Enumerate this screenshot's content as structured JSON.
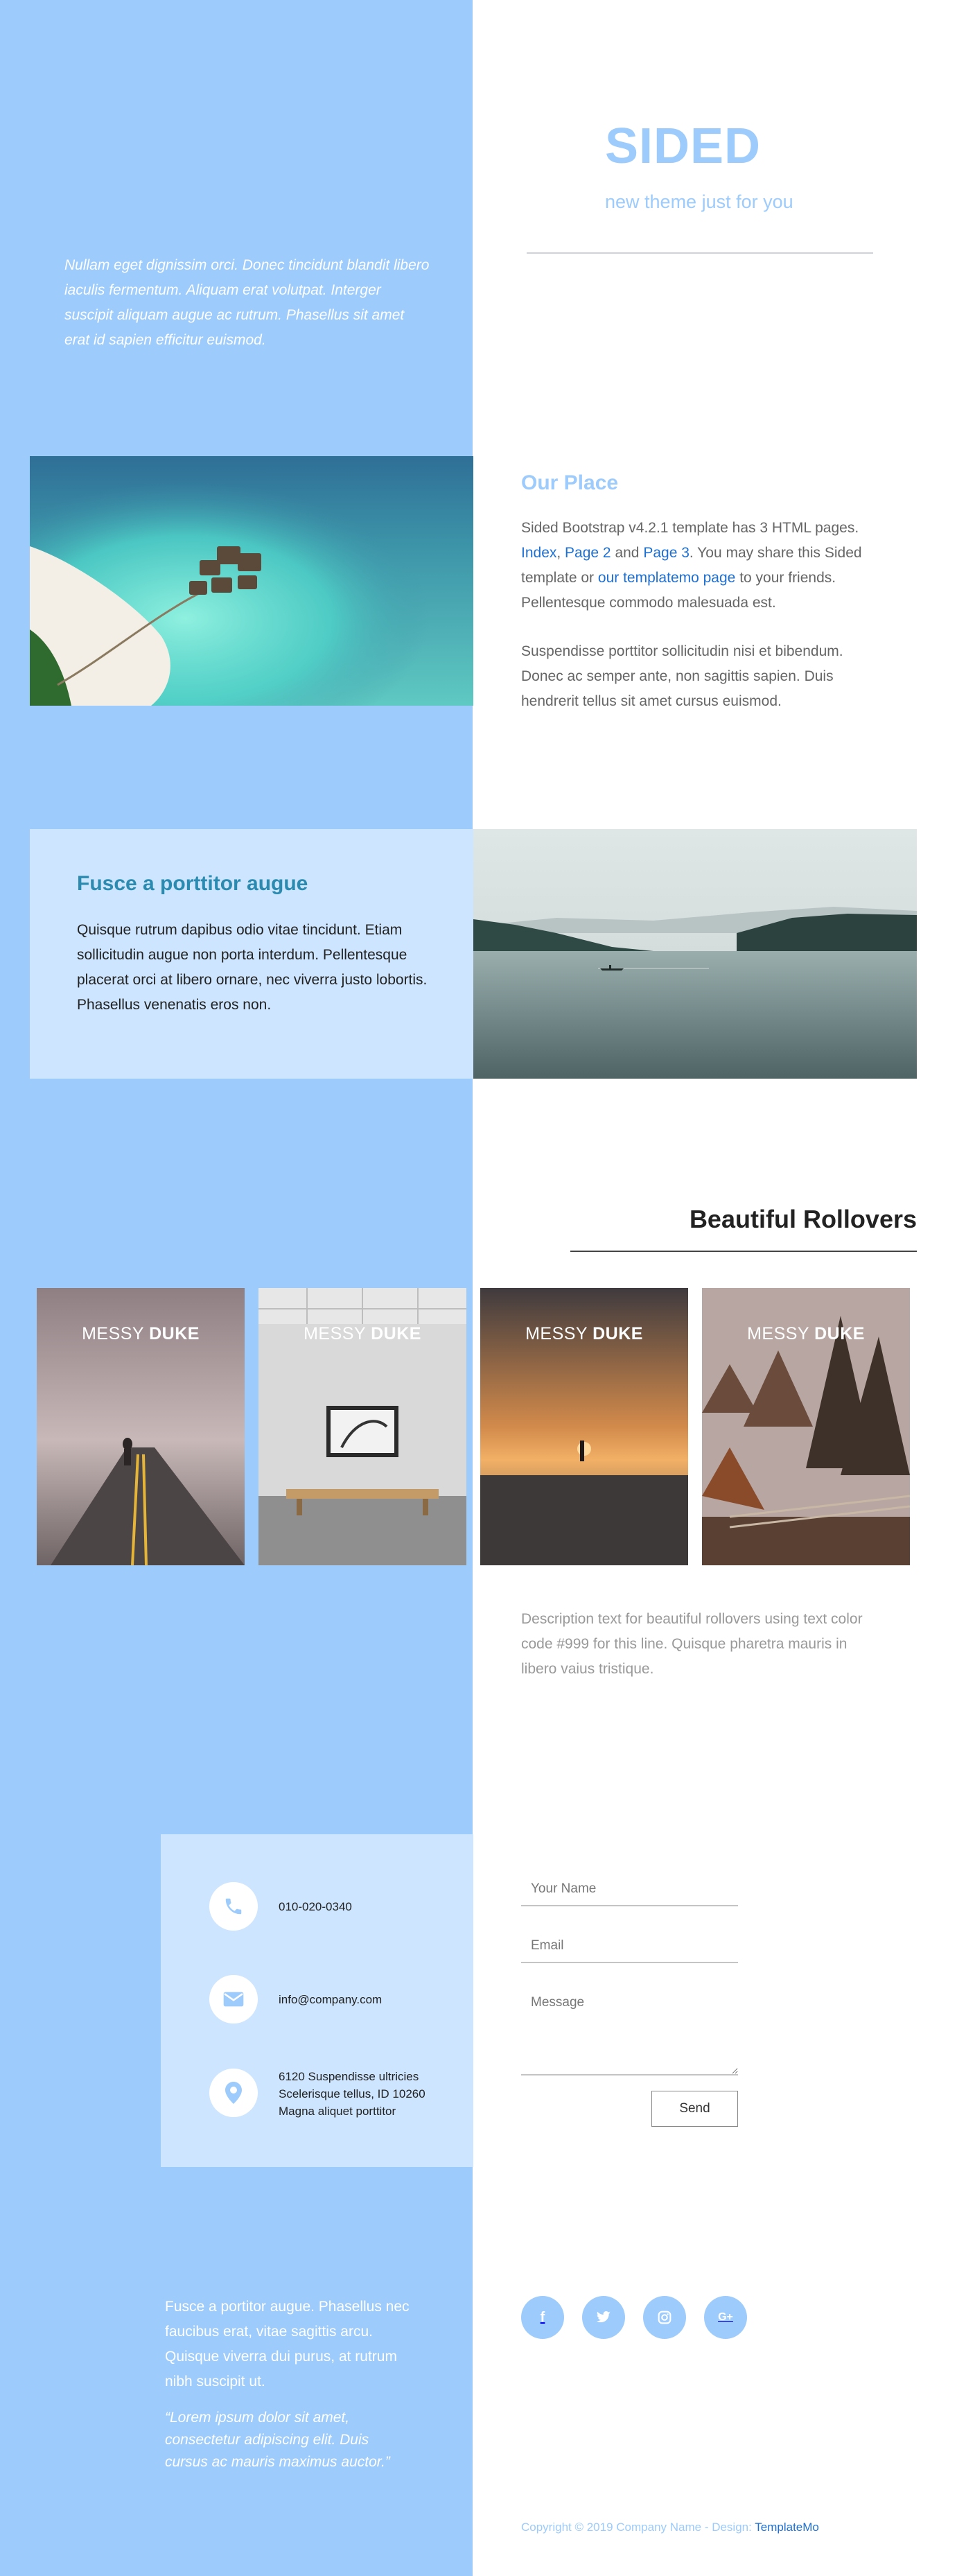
{
  "colors": {
    "accent": "#9ccbfc",
    "card": "#cde5fe",
    "link": "#1d6fd2",
    "teal_title": "#2b8ab0"
  },
  "hero": {
    "text": "Nullam eget dignissim orci. Donec tincidunt blandit libero iaculis fermentum. Aliquam erat volutpat. Interger suscipit aliquam augue ac rutrum. Phasellus sit amet erat id sapien efficitur euismod.",
    "brand_title": "SIDED",
    "brand_subtitle": "new theme just for you"
  },
  "place": {
    "title": "Our Place",
    "p1_a": "Sided Bootstrap v4.2.1 template has 3 HTML pages. ",
    "link_index": "Index",
    "sep1": ", ",
    "link_page2": "Page 2",
    "sep2": " and ",
    "link_page3": "Page 3",
    "p1_b": ". You may share this Sided template or ",
    "link_templatemo": "our templatemo page",
    "p1_c": " to your friends. Pellentesque commodo malesuada est.",
    "p2": "Suspendisse porttitor sollicitudin nisi et bibendum. Donec ac semper ante, non sagittis sapien. Duis hendrerit tellus sit amet cursus euismod."
  },
  "fusce": {
    "title": "Fusce a porttitor augue",
    "text": "Quisque rutrum dapibus odio vitae tincidunt. Etiam sollicitudin augue non porta interdum. Pellentesque placerat orci at libero ornare, nec viverra justo lobortis. Phasellus venenatis eros non."
  },
  "rollovers": {
    "title": "Beautiful Rollovers",
    "tiles": [
      {
        "caption_light": "MESSY",
        "caption_bold": "DUKE"
      },
      {
        "caption_light": "MESSY",
        "caption_bold": "DUKE"
      },
      {
        "caption_light": "MESSY",
        "caption_bold": "DUKE"
      },
      {
        "caption_light": "MESSY",
        "caption_bold": "DUKE"
      }
    ],
    "description": "Description text for beautiful rollovers using text color code #999 for this line. Quisque pharetra mauris in libero vaius tristique."
  },
  "contact": {
    "phone": "010-020-0340",
    "email": "info@company.com",
    "address_line1": "6120 Suspendisse ultricies",
    "address_line2": "Scelerisque tellus, ID 10260",
    "address_line3": "Magna aliquet porttitor",
    "icons": {
      "phone": "phone-icon",
      "email": "envelope-icon",
      "address": "map-marker-icon"
    }
  },
  "form": {
    "name_placeholder": "Your Name",
    "email_placeholder": "Email",
    "message_placeholder": "Message",
    "send_label": "Send"
  },
  "footer": {
    "text": "Fusce a portitor augue. Phasellus nec faucibus erat, vitae sagittis arcu. Quisque viverra dui purus, at rutrum nibh suscipit ut.",
    "quote": "“Lorem ipsum dolor sit amet, consectetur adipiscing elit. Duis cursus ac mauris maximus auctor.”",
    "social": [
      {
        "icon": "facebook-icon",
        "glyph": "f"
      },
      {
        "icon": "twitter-icon",
        "glyph": ""
      },
      {
        "icon": "instagram-icon",
        "glyph": ""
      },
      {
        "icon": "google-plus-icon",
        "glyph": "G+"
      }
    ],
    "copyright_prefix": "Copyright © 2019 Company Name - Design: ",
    "copyright_link": "TemplateMo"
  }
}
